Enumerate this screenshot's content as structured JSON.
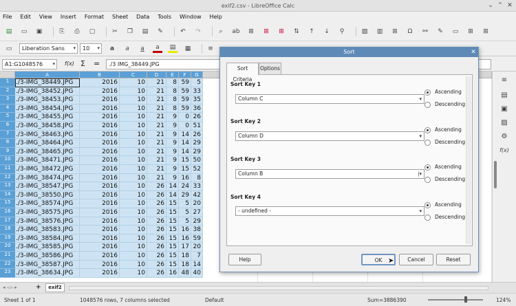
{
  "window": {
    "title": "exif2.csv - LibreOffice Calc",
    "minimize_icon": "chevron-down-icon",
    "maximize_icon": "chevron-up-icon",
    "close_icon": "close-icon"
  },
  "menu": [
    "File",
    "Edit",
    "View",
    "Insert",
    "Format",
    "Sheet",
    "Data",
    "Tools",
    "Window",
    "Help"
  ],
  "format_bar": {
    "font_name": "Liberation Sans",
    "font_size": "10"
  },
  "formula_bar": {
    "name_box": "A1:G1048576",
    "fx_label": "f(x)",
    "sum_label": "Σ",
    "eq_label": "=",
    "content": "./3 IMG_38449.JPG"
  },
  "grid": {
    "columns": [
      "A",
      "B",
      "C",
      "D",
      "E",
      "F",
      "G"
    ],
    "rows": [
      {
        "n": "1",
        "a": "./3-IMG_38449.JPG",
        "b": "2016",
        "c": "10",
        "d": "21",
        "e": "8",
        "f": "59",
        "g": "5"
      },
      {
        "n": "2",
        "a": "./3-IMG_38452.JPG",
        "b": "2016",
        "c": "10",
        "d": "21",
        "e": "8",
        "f": "59",
        "g": "33"
      },
      {
        "n": "3",
        "a": "./3-IMG_38453.JPG",
        "b": "2016",
        "c": "10",
        "d": "21",
        "e": "8",
        "f": "59",
        "g": "35"
      },
      {
        "n": "4",
        "a": "./3-IMG_38454.JPG",
        "b": "2016",
        "c": "10",
        "d": "21",
        "e": "8",
        "f": "59",
        "g": "36"
      },
      {
        "n": "5",
        "a": "./3-IMG_38455.JPG",
        "b": "2016",
        "c": "10",
        "d": "21",
        "e": "9",
        "f": "0",
        "g": "26"
      },
      {
        "n": "6",
        "a": "./3-IMG_38458.JPG",
        "b": "2016",
        "c": "10",
        "d": "21",
        "e": "9",
        "f": "0",
        "g": "51"
      },
      {
        "n": "7",
        "a": "./3-IMG_38463.JPG",
        "b": "2016",
        "c": "10",
        "d": "21",
        "e": "9",
        "f": "14",
        "g": "26"
      },
      {
        "n": "8",
        "a": "./3-IMG_38464.JPG",
        "b": "2016",
        "c": "10",
        "d": "21",
        "e": "9",
        "f": "14",
        "g": "29"
      },
      {
        "n": "9",
        "a": "./3-IMG_38465.JPG",
        "b": "2016",
        "c": "10",
        "d": "21",
        "e": "9",
        "f": "14",
        "g": "29"
      },
      {
        "n": "10",
        "a": "./3-IMG_38471.JPG",
        "b": "2016",
        "c": "10",
        "d": "21",
        "e": "9",
        "f": "15",
        "g": "50"
      },
      {
        "n": "11",
        "a": "./3-IMG_38472.JPG",
        "b": "2016",
        "c": "10",
        "d": "21",
        "e": "9",
        "f": "15",
        "g": "52"
      },
      {
        "n": "12",
        "a": "./3-IMG_38474.JPG",
        "b": "2016",
        "c": "10",
        "d": "21",
        "e": "9",
        "f": "16",
        "g": "8"
      },
      {
        "n": "13",
        "a": "./3-IMG_38547.JPG",
        "b": "2016",
        "c": "10",
        "d": "26",
        "e": "14",
        "f": "24",
        "g": "33"
      },
      {
        "n": "14",
        "a": "./3-IMG_38550.JPG",
        "b": "2016",
        "c": "10",
        "d": "26",
        "e": "14",
        "f": "29",
        "g": "42"
      },
      {
        "n": "15",
        "a": "./3-IMG_38574.JPG",
        "b": "2016",
        "c": "10",
        "d": "26",
        "e": "15",
        "f": "5",
        "g": "20"
      },
      {
        "n": "16",
        "a": "./3-IMG_38575.JPG",
        "b": "2016",
        "c": "10",
        "d": "26",
        "e": "15",
        "f": "5",
        "g": "27"
      },
      {
        "n": "17",
        "a": "./3-IMG_38576.JPG",
        "b": "2016",
        "c": "10",
        "d": "26",
        "e": "15",
        "f": "5",
        "g": "29"
      },
      {
        "n": "18",
        "a": "./3-IMG_38583.JPG",
        "b": "2016",
        "c": "10",
        "d": "26",
        "e": "15",
        "f": "16",
        "g": "38"
      },
      {
        "n": "19",
        "a": "./3-IMG_38584.JPG",
        "b": "2016",
        "c": "10",
        "d": "26",
        "e": "15",
        "f": "16",
        "g": "59"
      },
      {
        "n": "20",
        "a": "./3-IMG_38585.JPG",
        "b": "2016",
        "c": "10",
        "d": "26",
        "e": "15",
        "f": "17",
        "g": "20"
      },
      {
        "n": "21",
        "a": "./3-IMG_38586.JPG",
        "b": "2016",
        "c": "10",
        "d": "26",
        "e": "15",
        "f": "18",
        "g": "7"
      },
      {
        "n": "22",
        "a": "./3-IMG_38587.JPG",
        "b": "2016",
        "c": "10",
        "d": "26",
        "e": "15",
        "f": "18",
        "g": "14"
      },
      {
        "n": "23",
        "a": "./3-IMG_38634.JPG",
        "b": "2016",
        "c": "10",
        "d": "26",
        "e": "16",
        "f": "48",
        "g": "40"
      }
    ]
  },
  "sheet_tabs": {
    "tab": "exif2"
  },
  "status": {
    "sheet": "Sheet 1 of 1",
    "selection": "1048576 rows, 7 columns selected",
    "style": "Default",
    "sum": "Sum=3886390",
    "zoom": "124%"
  },
  "dialog": {
    "title": "Sort",
    "tabs": [
      "Sort Criteria",
      "Options"
    ],
    "keys": [
      {
        "label": "Sort Key 1",
        "value": "Column C",
        "asc": "Ascending",
        "desc": "Descending"
      },
      {
        "label": "Sort Key 2",
        "value": "Column D",
        "asc": "Ascending",
        "desc": "Descending"
      },
      {
        "label": "Sort Key 3",
        "value": "Column B",
        "asc": "Ascending",
        "desc": "Descending"
      },
      {
        "label": "Sort Key 4",
        "value": "- undefined -",
        "asc": "Ascending",
        "desc": "Descending"
      }
    ],
    "buttons": {
      "help": "Help",
      "ok": "OK",
      "cancel": "Cancel",
      "reset": "Reset"
    }
  },
  "colors": {
    "selection": "#cde3f3",
    "header_selected": "#5aa0d6",
    "dialog_title": "#5e8ab8"
  }
}
